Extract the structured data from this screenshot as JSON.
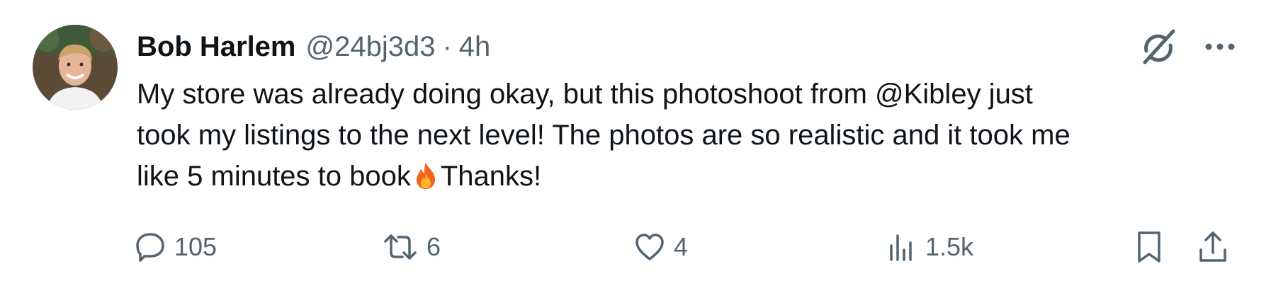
{
  "tweet": {
    "author_name": "Bob Harlem",
    "handle": "@24bj3d3",
    "separator": "·",
    "time": "4h",
    "lines": [
      "My store was already doing okay, but this photoshoot from @Kibley just",
      "took my listings to the next level! The photos are so realistic and it took me",
      "like 5 minutes to book"
    ],
    "line3_suffix": "Thanks!",
    "emoji": "fire-emoji"
  },
  "actions": {
    "replies": "105",
    "retweets": "6",
    "likes": "4",
    "views": "1.5k"
  },
  "icons": {
    "avatar": "avatar-photo",
    "grok": "grok-icon",
    "more": "more-options-icon",
    "reply": "reply-icon",
    "retweet": "retweet-icon",
    "like": "heart-icon",
    "views": "views-icon",
    "bookmark": "bookmark-icon",
    "share": "share-icon"
  },
  "colors": {
    "text_primary": "#0f1419",
    "text_secondary": "#536471",
    "background": "#ffffff"
  }
}
